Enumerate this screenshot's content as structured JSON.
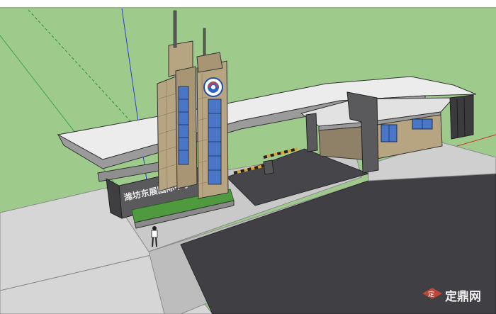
{
  "viewport": {
    "gate_sign_text": "潍坊东展国际中学",
    "watermark": {
      "logo_glyph": "定",
      "text": "定鼎网"
    },
    "colors": {
      "sky": "#ffffff",
      "ground": "#9ecb8c",
      "road": "#3f3f44",
      "pavement": "#c8c8c8",
      "wall_tan": "#b7a582",
      "wall_dark": "#555557",
      "roof_white": "#ececec",
      "glass": "#4a76c8",
      "red_axis": "#c9302c",
      "green_axis": "#3fa34d",
      "blue_axis": "#2e3fd6"
    }
  }
}
